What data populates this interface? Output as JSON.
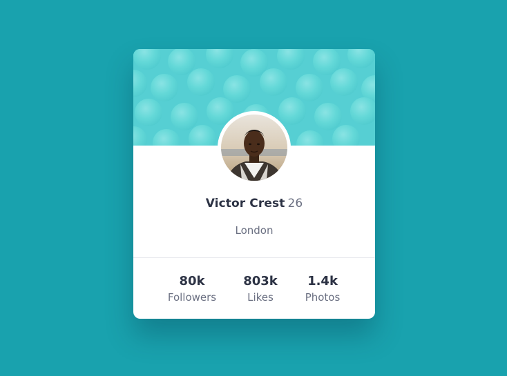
{
  "profile": {
    "name": "Victor Crest",
    "age": "26",
    "location": "London"
  },
  "stats": [
    {
      "value": "80k",
      "label": "Followers"
    },
    {
      "value": "803k",
      "label": "Likes"
    },
    {
      "value": "1.4k",
      "label": "Photos"
    }
  ],
  "colors": {
    "page_background": "#19a2ae",
    "banner": "#5ad2d5",
    "card": "#ffffff",
    "primary_text": "#2c3244",
    "secondary_text": "#6b7082"
  },
  "icons": {
    "banner": "bubble-pattern",
    "avatar": "profile-photo"
  }
}
